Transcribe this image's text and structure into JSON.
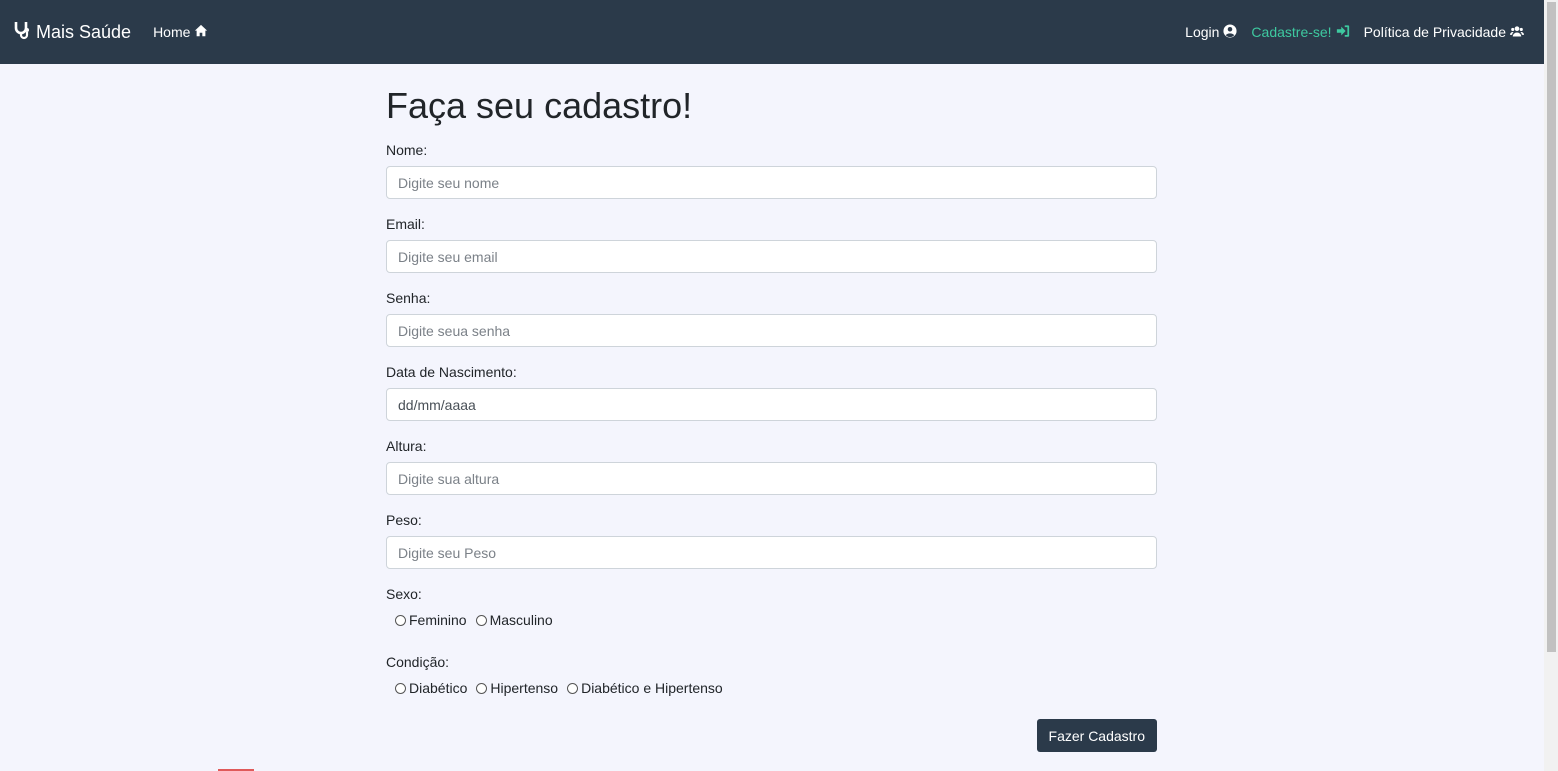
{
  "navbar": {
    "brand": "Mais Saúde",
    "brand_icon": "stethoscope-icon",
    "home": {
      "label": "Home",
      "icon": "home-icon"
    },
    "login": {
      "label": "Login",
      "icon": "user-circle-icon"
    },
    "signup": {
      "label": "Cadastre-se!",
      "icon": "sign-in-icon"
    },
    "privacy": {
      "label": "Política de Privacidade",
      "icon": "users-icon"
    },
    "colors": {
      "background": "#2b3a4a",
      "active": "#3ec9a0"
    }
  },
  "form": {
    "title": "Faça seu cadastro!",
    "fields": {
      "nome": {
        "label": "Nome:",
        "placeholder": "Digite seu nome"
      },
      "email": {
        "label": "Email:",
        "placeholder": "Digite seu email"
      },
      "senha": {
        "label": "Senha:",
        "placeholder": "Digite seua senha"
      },
      "nascimento": {
        "label": "Data de Nascimento:",
        "value": "dd/mm/aaaa"
      },
      "altura": {
        "label": "Altura:",
        "placeholder": "Digite sua altura"
      },
      "peso": {
        "label": "Peso:",
        "placeholder": "Digite seu Peso"
      }
    },
    "sexo": {
      "label": "Sexo:",
      "options": [
        "Feminino",
        "Masculino"
      ]
    },
    "condicao": {
      "label": "Condição:",
      "options": [
        "Diabético",
        "Hipertenso",
        "Diabético e Hipertenso"
      ]
    },
    "submit": "Fazer Cadastro"
  }
}
